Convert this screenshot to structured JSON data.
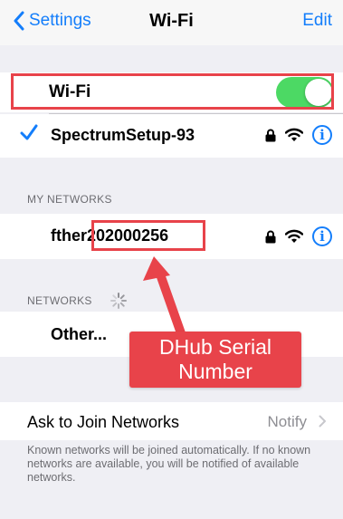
{
  "nav": {
    "back_label": "Settings",
    "title": "Wi-Fi",
    "edit_label": "Edit"
  },
  "wifi_toggle": {
    "label": "Wi-Fi",
    "on": true
  },
  "connected_network": {
    "name": "SpectrumSetup-93",
    "secured": true,
    "info_label": "i"
  },
  "my_networks": {
    "header": "MY NETWORKS",
    "items": [
      {
        "name_prefix": "fther",
        "name_serial": "202000256",
        "secured": true,
        "info_label": "i"
      }
    ]
  },
  "networks": {
    "header": "NETWORKS",
    "other_label": "Other..."
  },
  "ask_to_join": {
    "label": "Ask to Join Networks",
    "value": "Notify"
  },
  "footer_text": "Known networks will be joined automatically. If no known networks are available, you will be notified of available networks.",
  "annotation": {
    "line1": "DHub Serial",
    "line2": "Number"
  },
  "colors": {
    "ios_blue": "#147efb",
    "toggle_green": "#4cd964",
    "annotation_red": "#e8434a",
    "background": "#efeff4"
  }
}
